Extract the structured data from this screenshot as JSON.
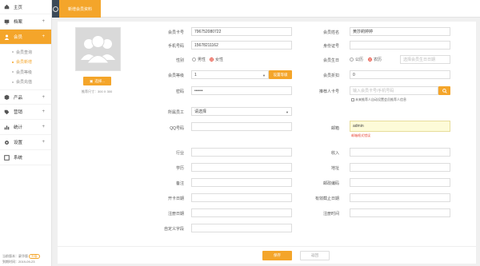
{
  "sidebar": {
    "items": [
      {
        "label": "主页",
        "icon": "home-icon",
        "plus": false
      },
      {
        "label": "档案",
        "icon": "monitor-icon",
        "plus": true
      },
      {
        "label": "会员",
        "icon": "user-icon",
        "plus": true,
        "active": true
      },
      {
        "label": "产品",
        "icon": "box-icon",
        "plus": true
      },
      {
        "label": "营销",
        "icon": "tag-icon",
        "plus": true
      },
      {
        "label": "统计",
        "icon": "chart-icon",
        "plus": true
      },
      {
        "label": "设置",
        "icon": "gear-icon",
        "plus": true
      },
      {
        "label": "系统",
        "icon": "system-icon",
        "plus": false
      }
    ],
    "subitems": [
      {
        "label": "会员查询",
        "active": false
      },
      {
        "label": "会员新增",
        "active": true
      },
      {
        "label": "会员等级",
        "active": false
      },
      {
        "label": "会员充值",
        "active": false
      }
    ],
    "footer": {
      "version_label": "当前版本：",
      "version_value": "豪华版",
      "badge": "升级",
      "expiry_label": "到期时间：",
      "expiry_value": "2019-09-23"
    }
  },
  "topbar": {
    "tab_label": "新增会员资料"
  },
  "photo": {
    "button_label": "选择...",
    "hint": "推荐尺寸：300 X 300"
  },
  "form": {
    "card_no": {
      "label": "会员卡号",
      "value": "796752080722"
    },
    "name": {
      "label": "会员姓名",
      "value": "黄莎莉婷婷"
    },
    "phone": {
      "label": "手机号码",
      "value": "15678211162"
    },
    "id_no": {
      "label": "身份证号",
      "value": ""
    },
    "gender": {
      "label": "性别",
      "options": [
        "男性",
        "女性"
      ],
      "selected": 1
    },
    "birthday": {
      "label": "会员生日",
      "options": [
        "公历",
        "农历"
      ],
      "selected": 1,
      "placeholder": "选择会员生日日期"
    },
    "level": {
      "label": "会员等级",
      "value": "1",
      "button": "设置等级"
    },
    "discount": {
      "label": "会员折扣",
      "value": "0"
    },
    "password": {
      "label": "密码",
      "value": "••••••"
    },
    "referrer": {
      "label": "推荐人卡号",
      "placeholder": "输入会员卡号/手机号码"
    },
    "referrer_note": "未来推荐人自动设置会员推荐人信息",
    "staff": {
      "label": "所属员工",
      "value": "请选择"
    },
    "qq": {
      "label": "QQ号码",
      "value": ""
    },
    "email": {
      "label": "邮箱",
      "value": "admin",
      "error": "邮箱格式错误"
    },
    "job": {
      "label": "行业",
      "value": ""
    },
    "income": {
      "label": "收入",
      "value": ""
    },
    "school": {
      "label": "学历",
      "value": ""
    },
    "address": {
      "label": "地址",
      "value": ""
    },
    "remark": {
      "label": "备注",
      "value": ""
    },
    "postcode": {
      "label": "邮政编码",
      "value": ""
    },
    "open_date": {
      "label": "开卡日期",
      "value": ""
    },
    "expire_date": {
      "label": "有效截止日期",
      "value": ""
    },
    "register_date": {
      "label": "注册日期",
      "value": ""
    },
    "register_time": {
      "label": "注册时间",
      "value": ""
    },
    "custom": {
      "label": "自定义字段",
      "value": ""
    }
  },
  "actions": {
    "save": "保存",
    "cancel": "返回"
  },
  "colors": {
    "accent": "#f4a52a",
    "error": "#e74c3c",
    "nav_dark": "#3c4a58"
  }
}
